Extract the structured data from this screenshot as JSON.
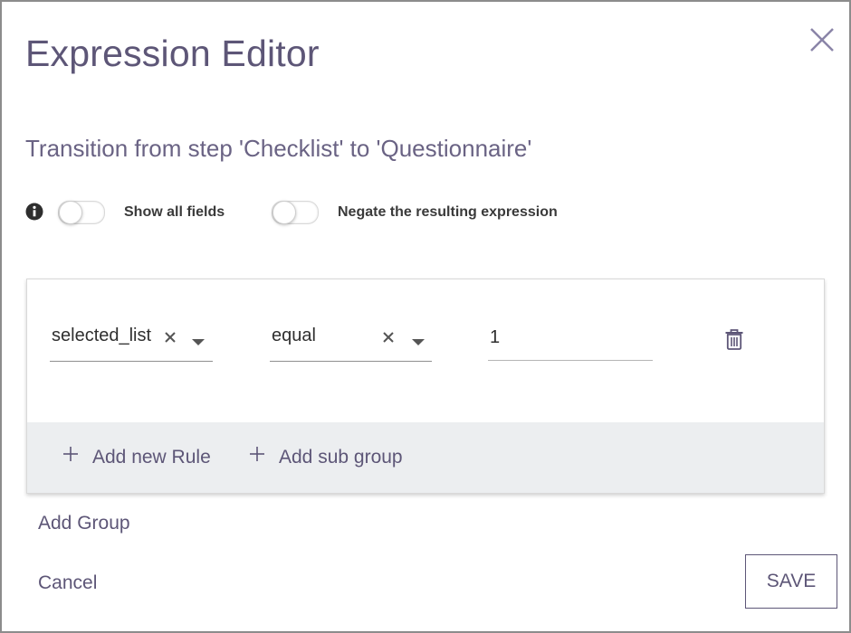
{
  "dialog": {
    "title": "Expression Editor",
    "subtitle": "Transition from step 'Checklist' to 'Questionnaire'",
    "close_icon": "close-icon"
  },
  "toggles": {
    "info_icon": "info-icon",
    "show_all_fields": {
      "label": "Show all fields",
      "checked": false
    },
    "negate_expression": {
      "label": "Negate the resulting expression",
      "checked": false
    }
  },
  "rule": {
    "field_value": "selected_list",
    "operator_value": "equal",
    "operand_value": "1",
    "delete_icon": "trash-icon"
  },
  "group_actions": {
    "add_rule_label": "Add new Rule",
    "add_subgroup_label": "Add sub group"
  },
  "actions": {
    "add_group_label": "Add Group",
    "cancel_label": "Cancel",
    "save_label": "SAVE"
  },
  "colors": {
    "accent": "#5d5677",
    "footer_bg": "#eceef0",
    "border": "#8c8c8c"
  }
}
